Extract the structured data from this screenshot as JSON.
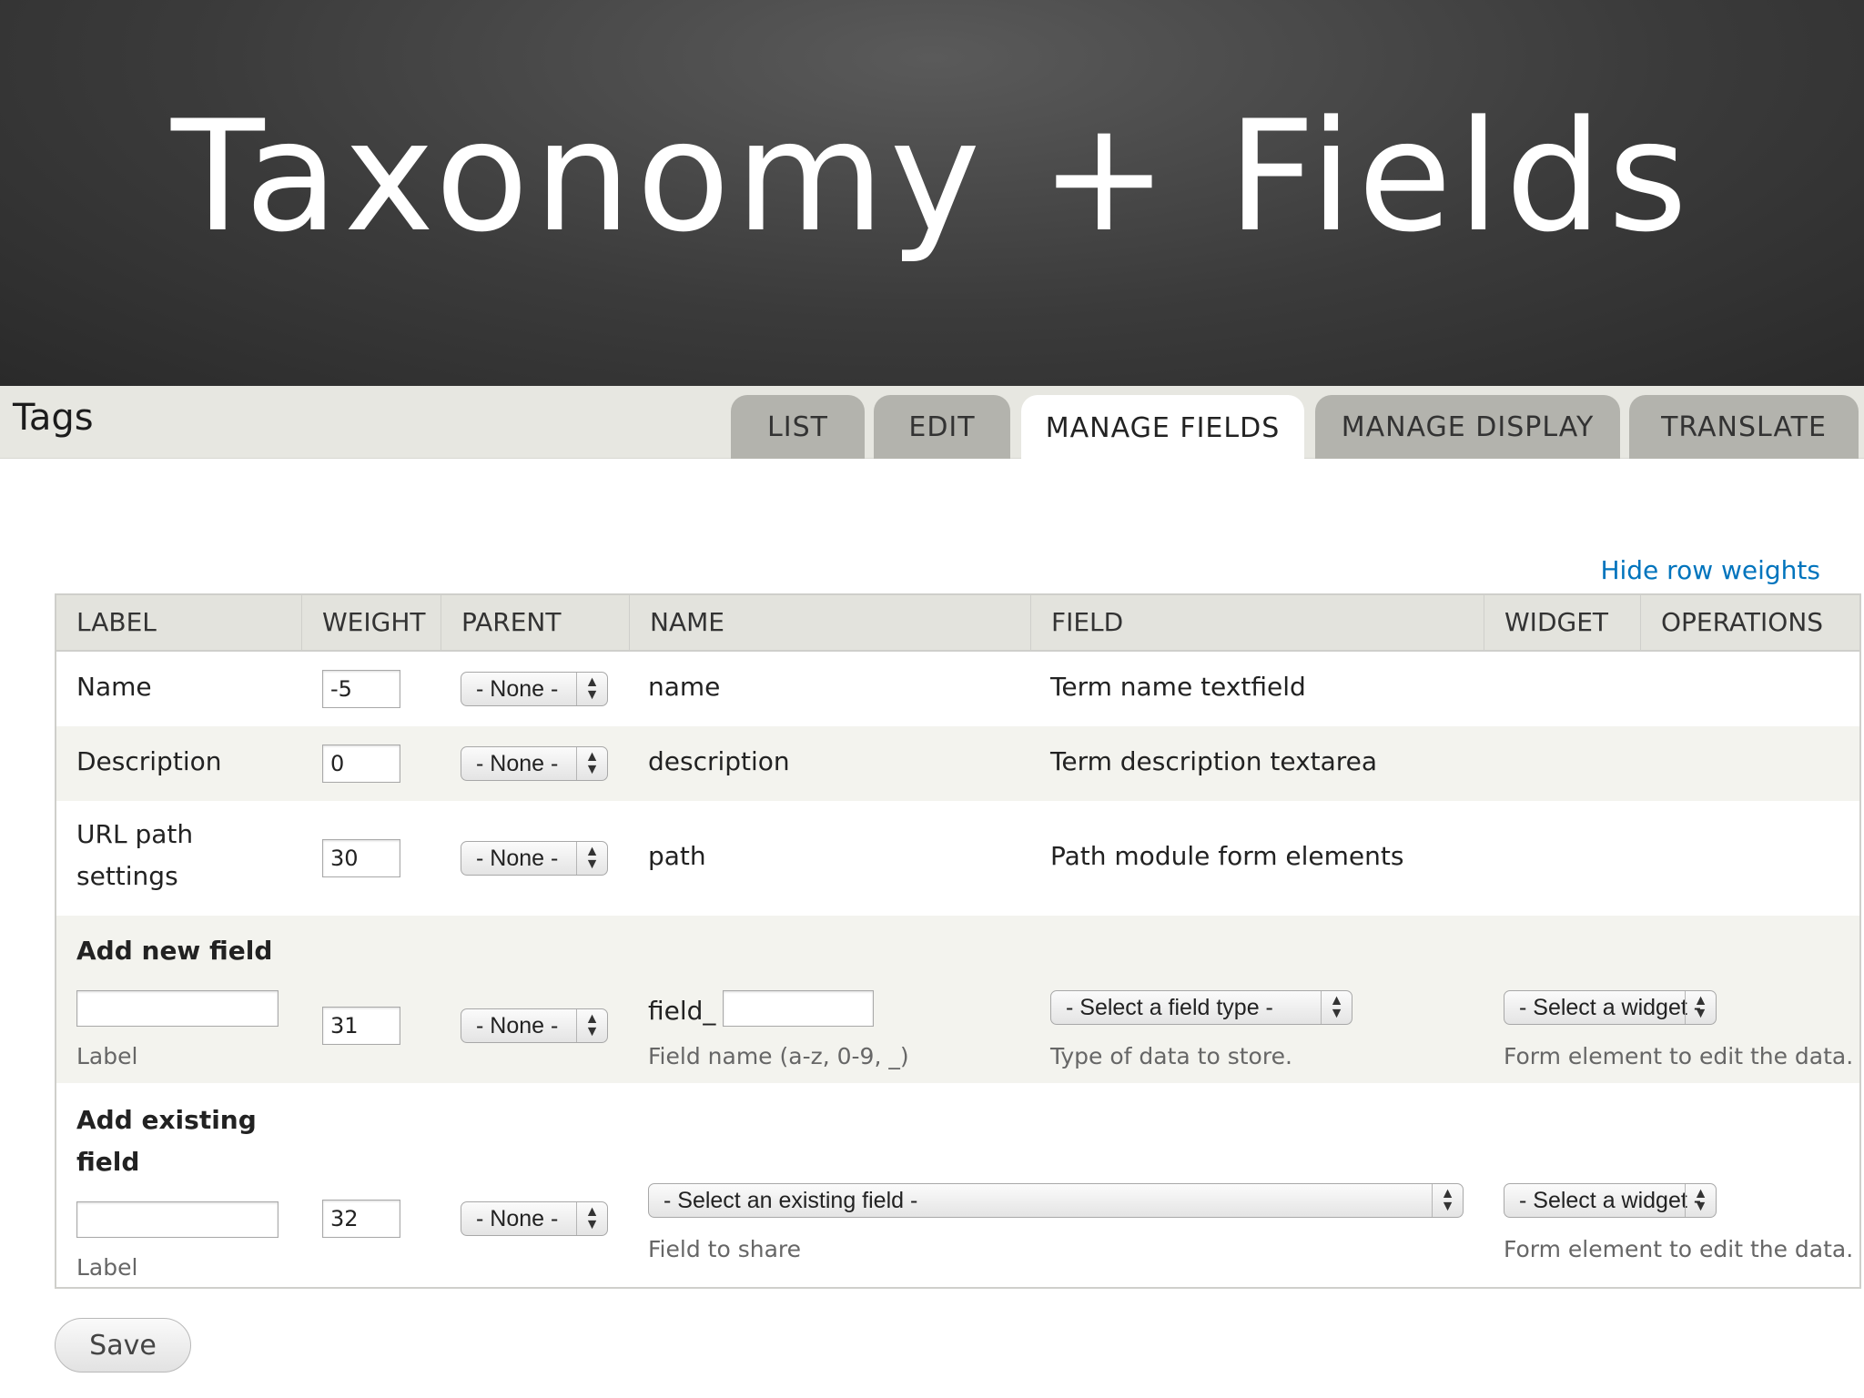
{
  "banner": {
    "title": "Taxonomy + Fields"
  },
  "header": {
    "page_title": "Tags",
    "tabs": [
      {
        "label": "LIST",
        "active": false
      },
      {
        "label": "EDIT",
        "active": false
      },
      {
        "label": "MANAGE FIELDS",
        "active": true
      },
      {
        "label": "MANAGE DISPLAY",
        "active": false
      },
      {
        "label": "TRANSLATE",
        "active": false
      }
    ]
  },
  "hide_row_weights": "Hide row weights",
  "table": {
    "columns": [
      "LABEL",
      "WEIGHT",
      "PARENT",
      "NAME",
      "FIELD",
      "WIDGET",
      "OPERATIONS"
    ],
    "rows": [
      {
        "label": "Name",
        "weight": "-5",
        "parent": "- None -",
        "name": "name",
        "field": "Term name textfield"
      },
      {
        "label": "Description",
        "weight": "0",
        "parent": "- None -",
        "name": "description",
        "field": "Term description textarea"
      },
      {
        "label_line1": "URL path",
        "label_line2": "settings",
        "weight": "30",
        "parent": "- None -",
        "name": "path",
        "field": "Path module form elements"
      }
    ],
    "add_new": {
      "title": "Add new field",
      "label_hint": "Label",
      "weight": "31",
      "parent": "- None -",
      "name_prefix": "field_",
      "name_hint": "Field name (a-z, 0-9, _)",
      "field_type_placeholder": "- Select a field type -",
      "field_type_hint": "Type of data to store.",
      "widget_placeholder": "- Select a widget -",
      "widget_hint": "Form element to edit the data."
    },
    "add_existing": {
      "title_line1": "Add existing",
      "title_line2": "field",
      "label_hint": "Label",
      "weight": "32",
      "parent": "- None -",
      "existing_placeholder": "- Select an existing field -",
      "existing_hint": "Field to share",
      "widget_placeholder": "- Select a widget -",
      "widget_hint": "Form element to edit the data."
    }
  },
  "save_label": "Save",
  "colors": {
    "link": "#0074bd",
    "tab_inactive": "#b3b3ad",
    "header_bg": "#e3e3dd"
  }
}
